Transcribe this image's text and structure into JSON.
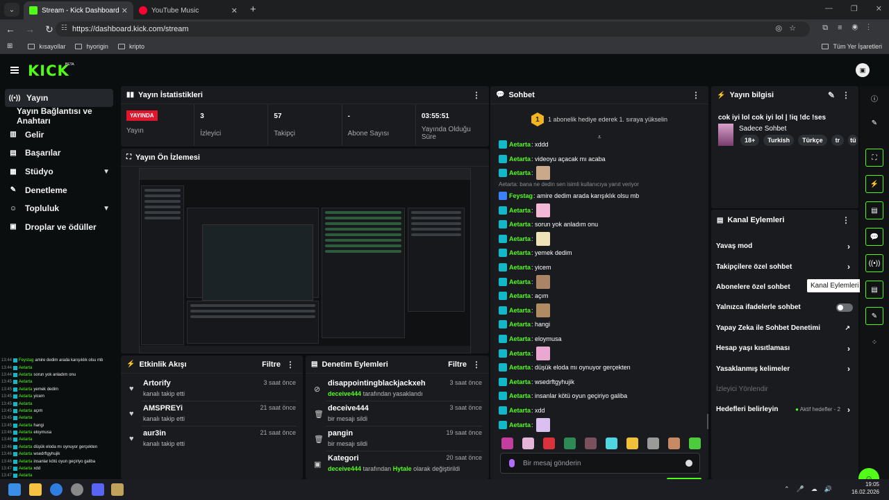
{
  "browser": {
    "tabs": [
      {
        "title": "Stream - Kick Dashboard",
        "active": true
      },
      {
        "title": "YouTube Music",
        "active": false
      }
    ],
    "url": "https://dashboard.kick.com/stream",
    "bookmarks": [
      "kısayollar",
      "hyorigin",
      "kripto"
    ],
    "all_bookmarks": "Tüm Yer İşaretleri"
  },
  "app": {
    "logo": "KICK",
    "beta": "BETA",
    "accent": "#53fc18",
    "sidebar": [
      {
        "label": "Yayın",
        "icon": "broadcast-icon"
      },
      {
        "label": "Yayın Bağlantısı ve Anahtarı",
        "icon": ""
      },
      {
        "label": "Gelir",
        "icon": "revenue-icon"
      },
      {
        "label": "Başarılar",
        "icon": "achievements-icon"
      },
      {
        "label": "Stüdyo",
        "icon": "studio-icon"
      },
      {
        "label": "Denetleme",
        "icon": "moderation-icon"
      },
      {
        "label": "Topluluk",
        "icon": "community-icon"
      },
      {
        "label": "Droplar ve ödüller",
        "icon": "drops-icon"
      }
    ]
  },
  "stats": {
    "title": "Yayın İstatistikleri",
    "live_badge": "YAYINDA",
    "items": [
      {
        "value": "",
        "label": "Yayın"
      },
      {
        "value": "3",
        "label": "İzleyici"
      },
      {
        "value": "57",
        "label": "Takipçi"
      },
      {
        "value": "-",
        "label": "Abone Sayısı"
      },
      {
        "value": "03:55:51",
        "label": "Yayında Olduğu Süre"
      }
    ]
  },
  "preview": {
    "title": "Yayın Ön İzlemesi"
  },
  "activity": {
    "title": "Etkinlik Akışı",
    "filter": "Filtre",
    "rows": [
      {
        "name": "Artorify",
        "sub": "kanalı takip etti",
        "time": "3 saat önce"
      },
      {
        "name": "AMSPREYi",
        "sub": "kanalı takip etti",
        "time": "21 saat önce"
      },
      {
        "name": "aur3in",
        "sub": "kanalı takip etti",
        "time": "21 saat önce"
      }
    ]
  },
  "modlog": {
    "title": "Denetim Eylemleri",
    "filter": "Filtre",
    "rows": [
      {
        "name": "disappointingblackjackxeh",
        "actor": "deceive444",
        "sub": "tarafından yasaklandı",
        "time": "3 saat önce"
      },
      {
        "name": "deceive444",
        "actor": "",
        "sub": "bir mesajı sildi",
        "time": "3 saat önce"
      },
      {
        "name": "pangin",
        "actor": "",
        "sub": "bir mesajı sildi",
        "time": "19 saat önce"
      },
      {
        "name": "Kategori",
        "actor": "deceive444",
        "sub": "tarafından",
        "target": "Hytale",
        "sub2": "olarak değiştirildi",
        "time": "20 saat önce"
      }
    ]
  },
  "chat": {
    "title": "Sohbet",
    "promo_badge": "1",
    "promo": "1 abonelik hediye ederek 1. sıraya yükselin",
    "reply_note": "Aetarta: bana ne dedin sen isimli kullanıcıya yanıt veriyor",
    "messages": [
      {
        "user": "Aetarta",
        "text": "xddd",
        "emote": ""
      },
      {
        "user": "Aetarta",
        "text": "videoyu açacak mı acaba",
        "emote": ""
      },
      {
        "user": "Aetarta",
        "text": "",
        "emote": "#c9a98a"
      },
      {
        "user": "Feystag",
        "text": "amire dedim arada karışıklık olsu mb",
        "emote": ""
      },
      {
        "user": "Aetarta",
        "text": "",
        "emote": "#f2b8d6"
      },
      {
        "user": "Aetarta",
        "text": "sorun yok anladım onu",
        "emote": ""
      },
      {
        "user": "Aetarta",
        "text": "",
        "emote": "#f0e2b8"
      },
      {
        "user": "Aetarta",
        "text": "yemek dedim",
        "emote": ""
      },
      {
        "user": "Aetarta",
        "text": "yicem",
        "emote": ""
      },
      {
        "user": "Aetarta",
        "text": "",
        "emote": "#a98466"
      },
      {
        "user": "Aetarta",
        "text": "açım",
        "emote": ""
      },
      {
        "user": "Aetarta",
        "text": "",
        "emote": "#b08a62"
      },
      {
        "user": "Aetarta",
        "text": "hangi",
        "emote": ""
      },
      {
        "user": "Aetarta",
        "text": "eloymusa",
        "emote": ""
      },
      {
        "user": "Aetarta",
        "text": "",
        "emote": "#e9a8cf"
      },
      {
        "user": "Aetarta",
        "text": "düşük eloda mı oynuyor gerçekten",
        "emote": ""
      },
      {
        "user": "Aetarta",
        "text": "wsedrftgyhujik",
        "emote": ""
      },
      {
        "user": "Aetarta",
        "text": "insanlar kötü oyun geçiriyo galiba",
        "emote": ""
      },
      {
        "user": "Aetarta",
        "text": "xdd",
        "emote": ""
      },
      {
        "user": "Aetarta",
        "text": "",
        "emote": "#d9c0f0"
      }
    ],
    "input_placeholder": "Bir mesaj gönderin"
  },
  "stream_info": {
    "title": "Yayın bilgisi",
    "stream_title": "cok iyi lol cok iyi lol | !iq !dc !ses",
    "category": "Sadece Sohbet",
    "tags": [
      "18+",
      "Turkish",
      "Türkçe",
      "tr",
      "tü"
    ]
  },
  "channel_actions": {
    "title": "Kanal Eylemleri",
    "items": [
      {
        "label": "Yavaş mod",
        "control": "chevron"
      },
      {
        "label": "Takipçilere özel sohbet",
        "control": "chevron"
      },
      {
        "label": "Abonelere özel sohbet",
        "control": "none"
      },
      {
        "label": "Yalnızca ifadelerle sohbet",
        "control": "toggle"
      },
      {
        "label": "Yapay Zeka ile Sohbet Denetimi",
        "control": "external"
      },
      {
        "label": "Hesap yaşı kısıtlaması",
        "control": "chevron"
      },
      {
        "label": "Yasaklanmış kelimeler",
        "control": "chevron"
      },
      {
        "label": "İzleyici Yönlendir",
        "control": "none"
      },
      {
        "label": "Hedefleri belirleyin",
        "control": "chevron",
        "note": "Aktif hedefler - 2"
      }
    ],
    "tooltip": "Kanal Eylemleri"
  },
  "overlay_chat": [
    {
      "time": "13:44",
      "user": "Feystag",
      "text": "amire dedim arada karışıklık olsu mb"
    },
    {
      "time": "13:44",
      "user": "Aetarta",
      "text": ""
    },
    {
      "time": "13:44",
      "user": "Aetarta",
      "text": "sorun yok anladım onu"
    },
    {
      "time": "13:45",
      "user": "Aetarta",
      "text": ""
    },
    {
      "time": "13:45",
      "user": "Aetarta",
      "text": "yemek dedim"
    },
    {
      "time": "13:45",
      "user": "Aetarta",
      "text": "yicem"
    },
    {
      "time": "13:45",
      "user": "Aetarta",
      "text": ""
    },
    {
      "time": "13:45",
      "user": "Aetarta",
      "text": "açım"
    },
    {
      "time": "13:45",
      "user": "Aetarta",
      "text": ""
    },
    {
      "time": "13:45",
      "user": "Aetarta",
      "text": "hangi"
    },
    {
      "time": "13:46",
      "user": "Aetarta",
      "text": "eloymusa"
    },
    {
      "time": "13:46",
      "user": "Aetarta",
      "text": ""
    },
    {
      "time": "13:46",
      "user": "Aetarta",
      "text": "düşük eloda mı oynuyor gerçekten"
    },
    {
      "time": "13:46",
      "user": "Aetarta",
      "text": "wsedrftgyhujik"
    },
    {
      "time": "13:46",
      "user": "Aetarta",
      "text": "insanlar kötü oyun geçiriyo galiba"
    },
    {
      "time": "13:47",
      "user": "Aetarta",
      "text": "xdd"
    },
    {
      "time": "13:47",
      "user": "Aetarta",
      "text": ""
    }
  ],
  "taskbar": {
    "time": "19:05",
    "date": "16.02.2026"
  }
}
